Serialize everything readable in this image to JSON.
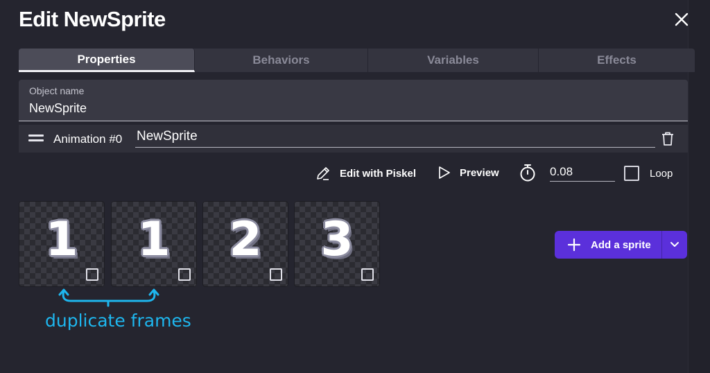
{
  "dialog": {
    "title": "Edit NewSprite",
    "close_icon": "close-icon"
  },
  "tabs": [
    {
      "label": "Properties",
      "active": true
    },
    {
      "label": "Behaviors",
      "active": false
    },
    {
      "label": "Variables",
      "active": false
    },
    {
      "label": "Effects",
      "active": false
    }
  ],
  "object_name": {
    "label": "Object name",
    "value": "NewSprite"
  },
  "animation": {
    "label": "Animation #0",
    "name": "NewSprite",
    "drag_icon": "drag-handle-icon",
    "delete_icon": "trash-icon"
  },
  "toolbar": {
    "edit_piskel_label": "Edit with Piskel",
    "preview_label": "Preview",
    "timer_value": "0.08",
    "loop_label": "Loop",
    "loop_checked": false
  },
  "frames": [
    {
      "glyph": "1",
      "checked": false
    },
    {
      "glyph": "1",
      "checked": false
    },
    {
      "glyph": "2",
      "checked": false
    },
    {
      "glyph": "3",
      "checked": false
    }
  ],
  "add_sprite": {
    "label": "Add a sprite",
    "icon": "plus-icon",
    "menu_icon": "chevron-down-icon"
  },
  "annotation": {
    "text": "duplicate frames",
    "color": "#1eb6ee"
  },
  "colors": {
    "background": "#25252f",
    "accent": "#5b30db"
  }
}
